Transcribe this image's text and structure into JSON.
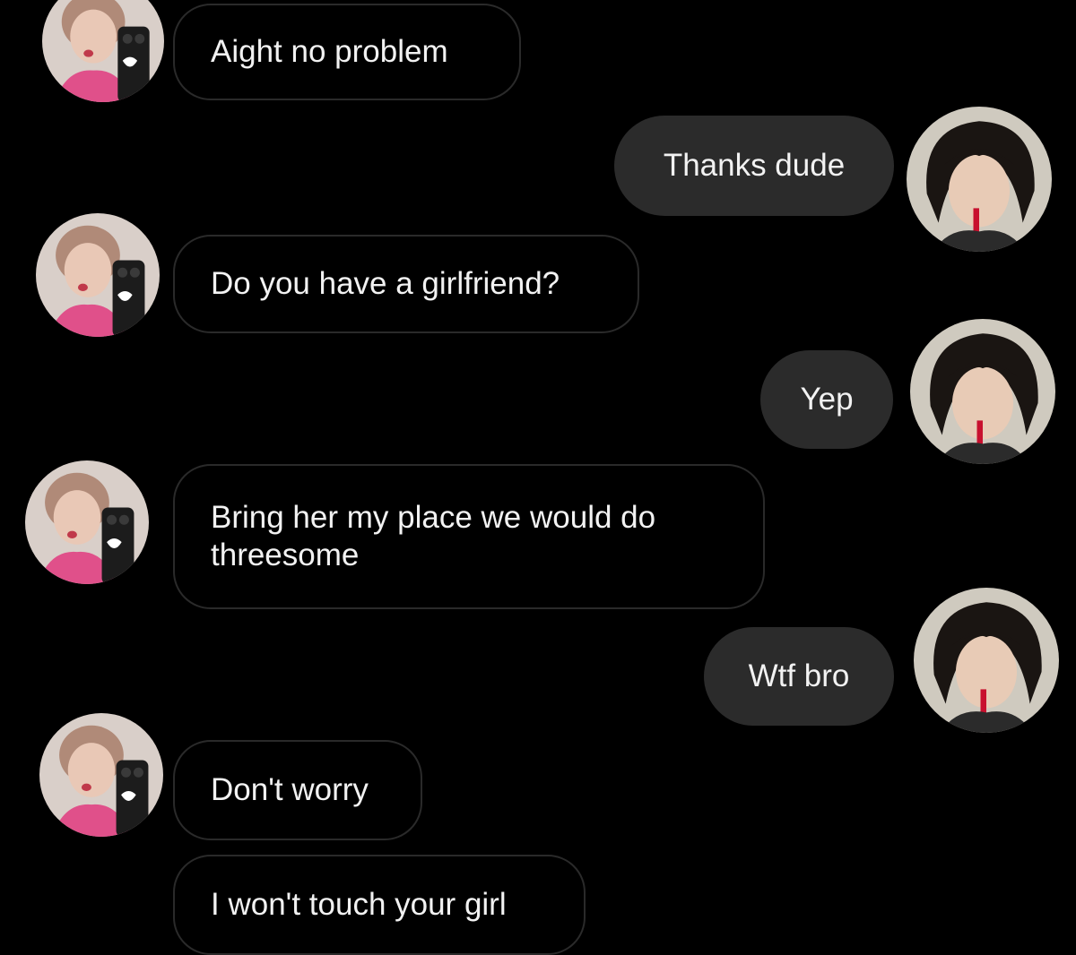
{
  "conversation": {
    "messages": [
      {
        "sender": "other",
        "text": "Aight no problem"
      },
      {
        "sender": "me",
        "text": "Thanks dude"
      },
      {
        "sender": "other",
        "text": "Do you have a girlfriend?"
      },
      {
        "sender": "me",
        "text": "Yep"
      },
      {
        "sender": "other",
        "text": "Bring her my place we would do\nthreesome"
      },
      {
        "sender": "me",
        "text": "Wtf bro"
      },
      {
        "sender": "other",
        "text": "Don't worry"
      },
      {
        "sender": "other",
        "text": "I won't touch your girl"
      }
    ]
  },
  "participants": {
    "other": {
      "avatar_icon": "profile-photo-pink-sweater-selfie"
    },
    "me": {
      "avatar_icon": "profile-photo-dark-hair"
    }
  },
  "colors": {
    "background": "#000000",
    "incoming_bubble_border": "#2a2a2a",
    "outgoing_bubble_fill": "#2b2b2b",
    "text": "#f2f2f2"
  }
}
